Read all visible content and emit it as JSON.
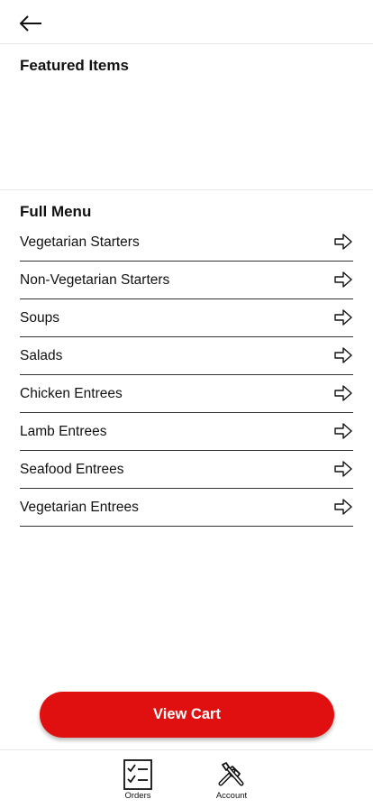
{
  "header": {
    "back_icon": "arrow-left-icon"
  },
  "featured": {
    "title": "Featured Items"
  },
  "menu": {
    "title": "Full Menu",
    "arrow_icon": "arrow-right-outline-icon",
    "items": [
      {
        "label": "Vegetarian Starters"
      },
      {
        "label": "Non-Vegetarian Starters"
      },
      {
        "label": "Soups"
      },
      {
        "label": "Salads"
      },
      {
        "label": "Chicken Entrees"
      },
      {
        "label": "Lamb Entrees"
      },
      {
        "label": "Seafood Entrees"
      },
      {
        "label": "Vegetarian Entrees"
      }
    ]
  },
  "cart": {
    "label": "View Cart",
    "color": "#e01010"
  },
  "nav": {
    "orders": {
      "label": "Orders",
      "icon": "checklist-icon"
    },
    "account": {
      "label": "Account",
      "icon": "tools-icon"
    }
  }
}
